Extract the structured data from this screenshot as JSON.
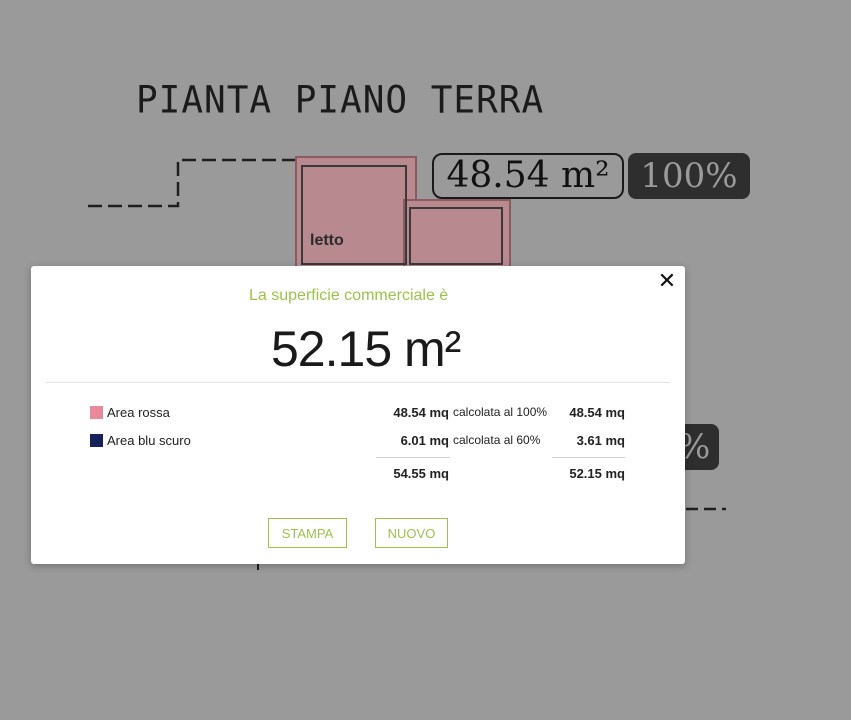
{
  "background": {
    "plan_title": "PIANTA PIANO TERRA",
    "room_label": "letto",
    "area_tag": "48.54 m²",
    "percent_tag": "100%",
    "percent_tag_2": "%"
  },
  "modal": {
    "subtitle": "La superficie commerciale è",
    "total": "52.15 m²",
    "close_glyph": "✕",
    "rows": [
      {
        "color": "#e8899c",
        "label": "Area rossa",
        "area": "48.54 mq",
        "calc": "calcolata al 100%",
        "result": "48.54 mq"
      },
      {
        "color": "#14215a",
        "label": "Area blu scuro",
        "area": "6.01 mq",
        "calc": "calcolata al 60%",
        "result": "3.61 mq"
      }
    ],
    "sum_area": "54.55 mq",
    "sum_result": "52.15 mq",
    "buttons": {
      "print": "STAMPA",
      "new": "NUOVO"
    }
  },
  "colors": {
    "accent": "#9cc24a",
    "overlay": "#9a9a9a"
  }
}
